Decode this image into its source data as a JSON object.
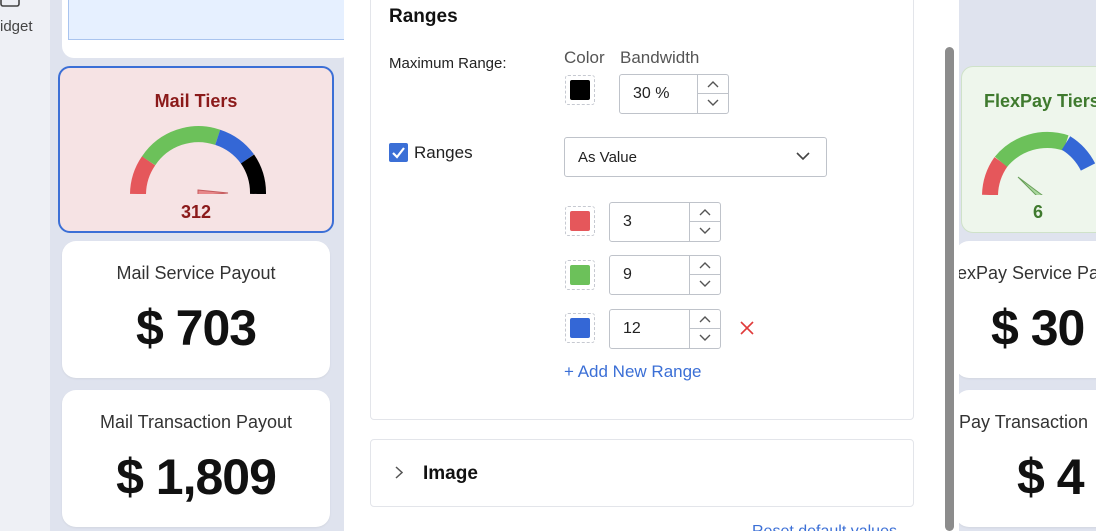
{
  "rail": {
    "label": "idget",
    "icon": "widget-icon"
  },
  "left_cards": {
    "gauge": {
      "title": "Mail Tiers",
      "value": "312",
      "bg": "#f6e3e4",
      "title_color": "#8b1a1a"
    },
    "service": {
      "title": "Mail Service Payout",
      "value": "$ 703"
    },
    "transaction": {
      "title": "Mail Transaction Payout",
      "value": "$ 1,809"
    }
  },
  "right_cards": {
    "gauge": {
      "title": "FlexPay Tiers",
      "value": "6",
      "bg": "#eef6ec",
      "title_color": "#3f7a2e"
    },
    "service": {
      "title": "exPay Service Pa",
      "value": "$ 30"
    },
    "transaction": {
      "title": "Pay Transaction",
      "value": "$ 4"
    }
  },
  "panel": {
    "section_title": "Ranges",
    "maximum_range_label": "Maximum Range:",
    "color_label": "Color",
    "bandwidth_label": "Bandwidth",
    "max_color": "#000000",
    "bandwidth_value": "30 %",
    "ranges_checkbox_label": "Ranges",
    "ranges_checked": true,
    "range_mode": "As Value",
    "ranges": [
      {
        "color": "#e5575b",
        "value": "3"
      },
      {
        "color": "#6cc15a",
        "value": "9"
      },
      {
        "color": "#3467d6",
        "value": "12"
      }
    ],
    "add_range_label": "+ Add New Range",
    "image_section_title": "Image",
    "bottom_link": "Reset default values"
  },
  "colors": {
    "accent": "#3b6fd6",
    "remove": "#e03a3a"
  }
}
